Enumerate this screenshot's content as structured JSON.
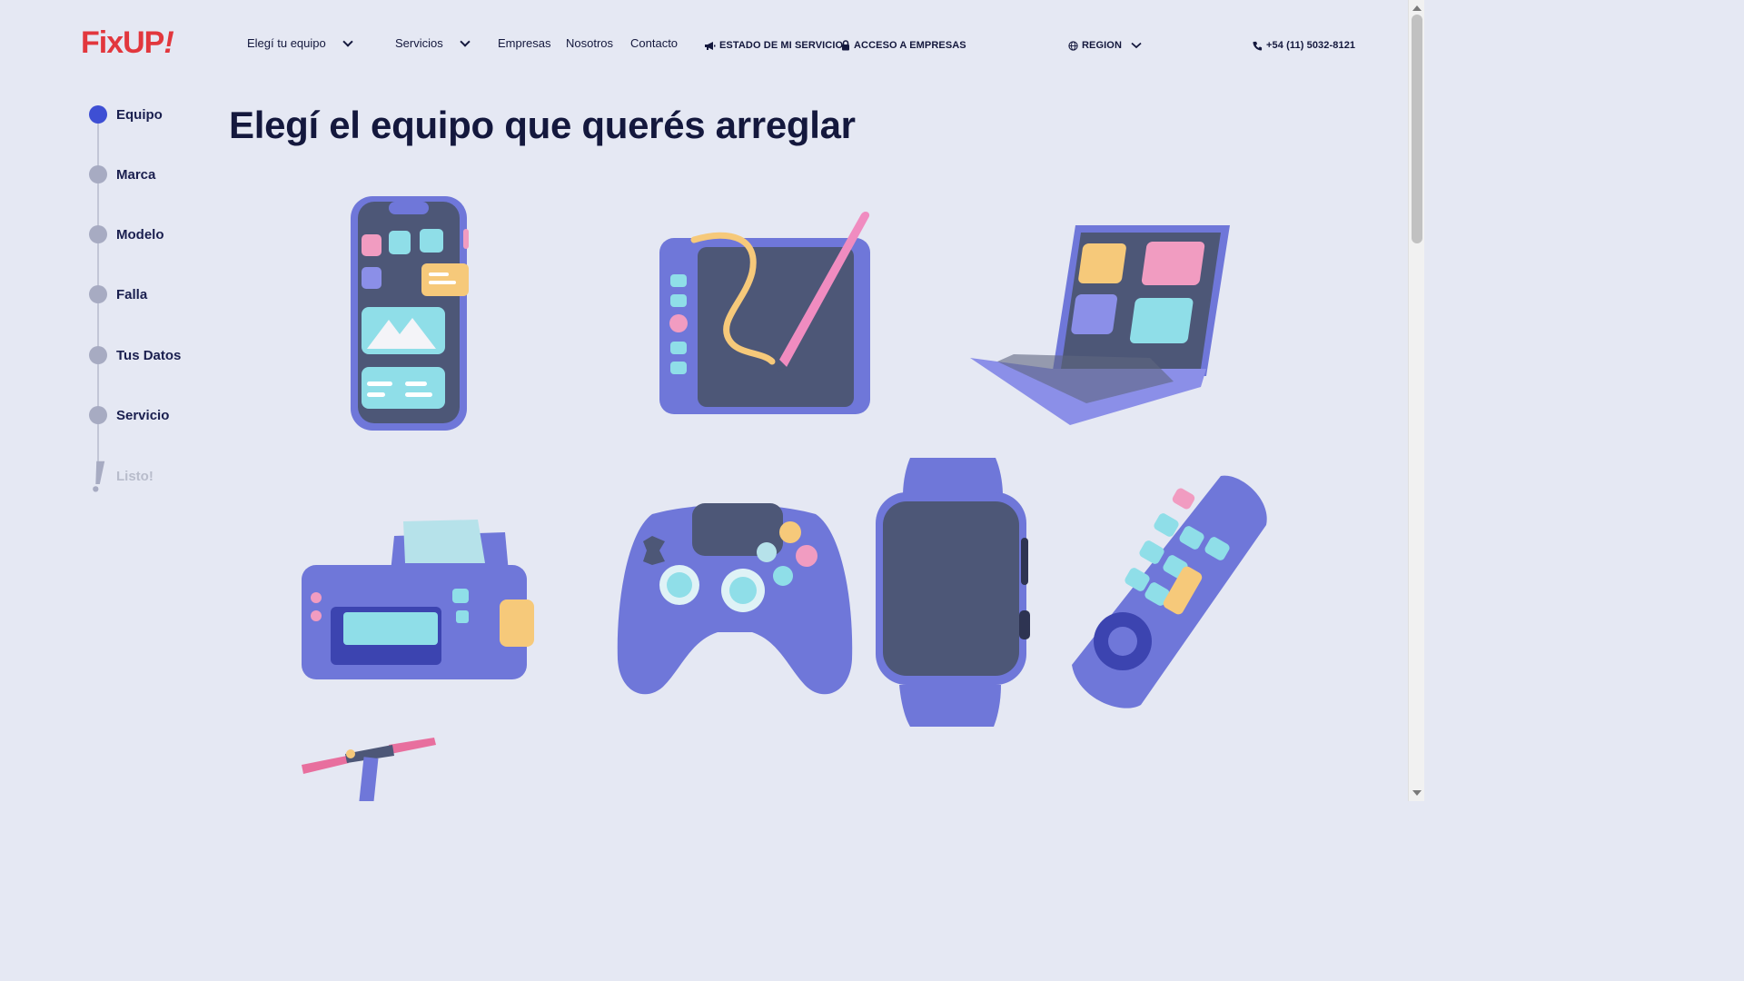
{
  "header": {
    "logo": {
      "part1": "Fix",
      "part2": "UP",
      "part3": "!"
    },
    "nav": {
      "equipo": "Elegí tu equipo",
      "servicios": "Servicios",
      "empresas": "Empresas",
      "nosotros": "Nosotros",
      "contacto": "Contacto",
      "estado": "ESTADO DE MI SERVICIO",
      "acceso": "ACCESO A EMPRESAS",
      "region": "REGION",
      "phone": "+54 (11) 5032-8121"
    }
  },
  "stepper": {
    "steps": [
      {
        "label": "Equipo"
      },
      {
        "label": "Marca"
      },
      {
        "label": "Modelo"
      },
      {
        "label": "Falla"
      },
      {
        "label": "Tus Datos"
      },
      {
        "label": "Servicio"
      },
      {
        "label": "Listo!"
      }
    ]
  },
  "main": {
    "title": "Elegí el equipo que querés arreglar",
    "devices": [
      {
        "icon": "smartphone-icon"
      },
      {
        "icon": "tablet-icon"
      },
      {
        "icon": "laptop-icon"
      },
      {
        "icon": "printer-icon"
      },
      {
        "icon": "gamepad-icon"
      },
      {
        "icon": "smartwatch-icon"
      },
      {
        "icon": "remote-control-icon"
      },
      {
        "icon": "scooter-icon"
      }
    ]
  },
  "colors": {
    "background": "#e5e8f3",
    "brand": "#e2373d",
    "active_step": "#3e4fd4",
    "device_purple": "#6f77d9",
    "text_dark": "#14183d"
  }
}
